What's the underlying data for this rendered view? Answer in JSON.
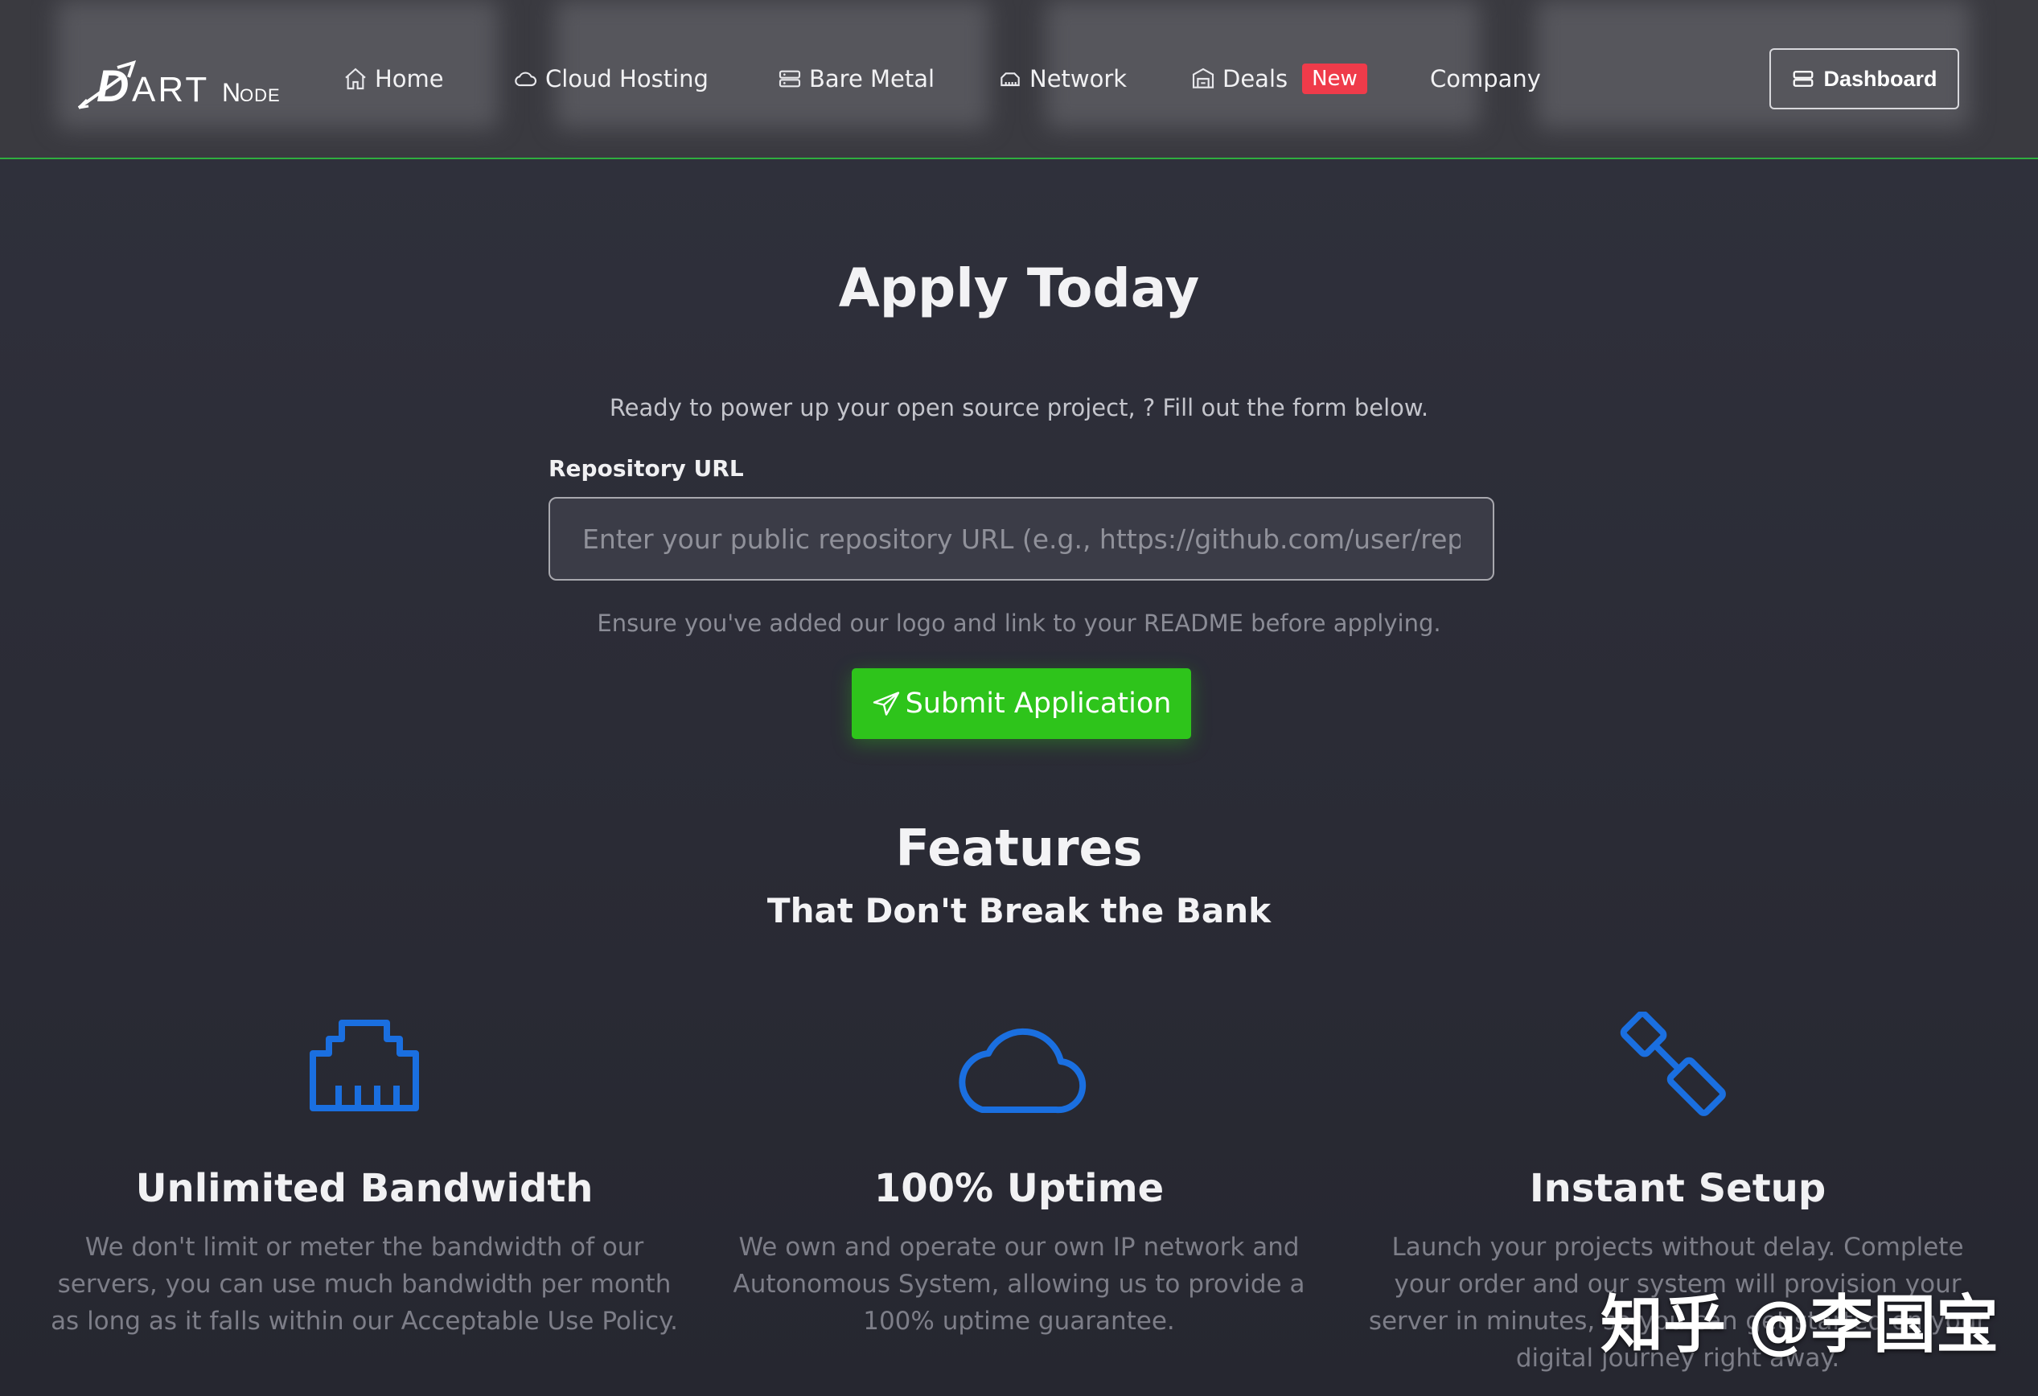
{
  "brand": {
    "logo_text": "DartNode"
  },
  "nav": {
    "items": [
      {
        "label": "Home",
        "icon": "home-icon"
      },
      {
        "label": "Cloud Hosting",
        "icon": "cloud-icon"
      },
      {
        "label": "Bare Metal",
        "icon": "server-icon"
      },
      {
        "label": "Network",
        "icon": "network-icon"
      },
      {
        "label": "Deals",
        "icon": "building-icon",
        "badge": "New"
      },
      {
        "label": "Company",
        "icon": ""
      }
    ],
    "dashboard_label": "Dashboard"
  },
  "apply": {
    "title": "Apply Today",
    "subtitle": "Ready to power up your open source project, ? Fill out the form below.",
    "repo_label": "Repository URL",
    "repo_placeholder": "Enter your public repository URL (e.g., https://github.com/user/repo)",
    "repo_value": "",
    "hint": "Ensure you've added our logo and link to your README before applying.",
    "submit_label": "Submit Application"
  },
  "features": {
    "title": "Features",
    "subtitle": "That Don't Break the Bank",
    "items": [
      {
        "icon": "ethernet-icon",
        "title": "Unlimited Bandwidth",
        "text": "We don't limit or meter the bandwidth of our servers, you can use much bandwidth per month as long as it falls within our Acceptable Use Policy."
      },
      {
        "icon": "cloud-icon",
        "title": "100% Uptime",
        "text": "We own and operate our own IP network and Autonomous System, allowing us to provide a 100% uptime guarantee."
      },
      {
        "icon": "plug-icon",
        "title": "Instant Setup",
        "text": "Launch your projects without delay. Complete your order and our system will provision your server in minutes, so you can get started on your digital journey right away."
      }
    ]
  },
  "watermark": "知乎 @李国宝",
  "colors": {
    "accent_green": "#2ec41b",
    "badge_red": "#ef3b4a",
    "icon_blue": "#1a6fe0"
  }
}
